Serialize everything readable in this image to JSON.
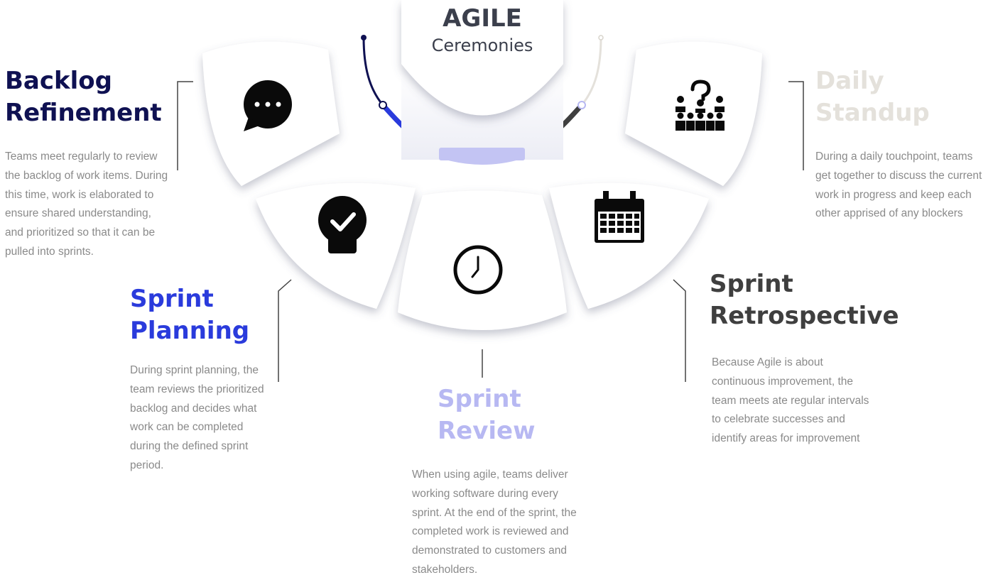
{
  "title": {
    "main": "AGILE",
    "sub": "Ceremonies"
  },
  "colors": {
    "navy": "#0f1152",
    "blue": "#2a3bdc",
    "lavender": "#b7b8f2",
    "dark_gray": "#3f3f3f",
    "light_beige": "#e4e1db",
    "desc_gray": "#8a8a8a"
  },
  "ceremonies": [
    {
      "heading_line1": "Backlog",
      "heading_line2": "Refinement",
      "color": "#0f1152",
      "icon": "chat-bubble-icon",
      "description": "Teams meet regularly to review the backlog of work items. During this time, work is elaborated to ensure shared understanding, and prioritized so that it can be pulled into sprints."
    },
    {
      "heading_line1": "Sprint",
      "heading_line2": "Planning",
      "color": "#2a3bdc",
      "icon": "check-badge-icon",
      "description": "During sprint planning, the team reviews the prioritized backlog and decides what work can be completed during the defined sprint period."
    },
    {
      "heading_line1": "Sprint",
      "heading_line2": "Review",
      "color": "#b7b8f2",
      "icon": "clock-icon",
      "description": "When using agile, teams deliver working software during every sprint. At the end of the sprint, the completed work is reviewed and demonstrated to customers and stakeholders."
    },
    {
      "heading_line1": "Sprint",
      "heading_line2": "Retrospective",
      "color": "#3f3f3f",
      "icon": "calendar-icon",
      "description": "Because Agile is about continuous improvement, the team meets ate regular intervals to celebrate successes and identify areas for improvement"
    },
    {
      "heading_line1": "Daily",
      "heading_line2": "Standup",
      "color": "#e4e1db",
      "icon": "team-question-icon",
      "description": "During a daily touchpoint, teams get together to discuss the current work in progress and keep each other apprised of any blockers"
    }
  ]
}
